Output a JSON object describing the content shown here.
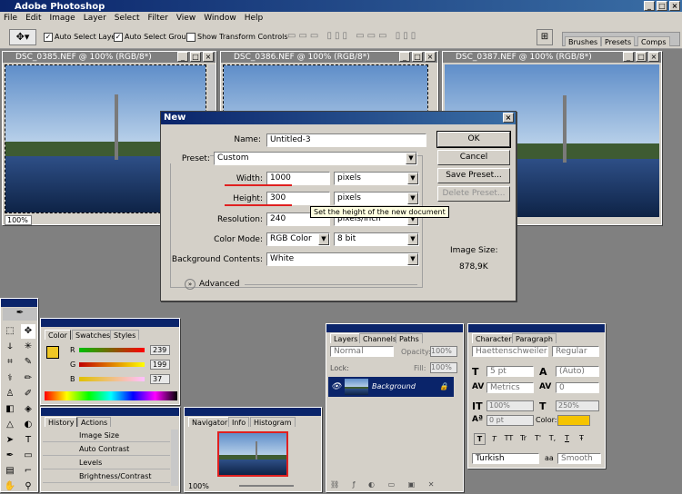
{
  "app": {
    "title": "Adobe Photoshop"
  },
  "menu": [
    "File",
    "Edit",
    "Image",
    "Layer",
    "Select",
    "Filter",
    "View",
    "Window",
    "Help"
  ],
  "options": {
    "auto_select_layer": "Auto Select Layer",
    "auto_select_groups": "Auto Select Groups",
    "show_transform": "Show Transform Controls",
    "auto_select_layer_checked": true,
    "auto_select_groups_checked": true,
    "show_transform_checked": false
  },
  "well_tabs": [
    "Brushes",
    "Presets",
    "Comps"
  ],
  "documents": [
    {
      "title": "DSC_0385.NEF @ 100% (RGB/8*)",
      "zoom": "100%"
    },
    {
      "title": "DSC_0386.NEF @ 100% (RGB/8*)"
    },
    {
      "title": "DSC_0387.NEF @ 100% (RGB/8*)"
    }
  ],
  "dialog": {
    "title": "New",
    "name_label": "Name:",
    "name_value": "Untitled-3",
    "preset_label": "Preset:",
    "preset_value": "Custom",
    "width_label": "Width:",
    "width_value": "1000",
    "width_unit": "pixels",
    "height_label": "Height:",
    "height_value": "300",
    "height_unit": "pixels",
    "resolution_label": "Resolution:",
    "resolution_value": "240",
    "resolution_unit": "pixels/inch",
    "tooltip": "Set the height of the new document",
    "color_mode_label": "Color Mode:",
    "color_mode_value": "RGB Color",
    "bit_value": "8 bit",
    "bg_label": "Background Contents:",
    "bg_value": "White",
    "advanced_label": "Advanced",
    "ok": "OK",
    "cancel": "Cancel",
    "save_preset": "Save Preset...",
    "delete_preset": "Delete Preset...",
    "image_size_label": "Image Size:",
    "image_size_value": "878,9K"
  },
  "color_panel": {
    "tabs": [
      "Color",
      "Swatches",
      "Styles"
    ],
    "r": "239",
    "g": "199",
    "b": "37",
    "r_label": "R",
    "g_label": "G",
    "b_label": "B",
    "fg_color": "#efc725"
  },
  "history_panel": {
    "tabs": [
      "History",
      "Actions"
    ],
    "items": [
      "Image Size",
      "Auto Contrast",
      "Levels",
      "Brightness/Contrast"
    ]
  },
  "navigator_panel": {
    "tabs": [
      "Navigator",
      "Info",
      "Histogram"
    ],
    "zoom": "100%"
  },
  "layers_panel": {
    "tabs": [
      "Layers",
      "Channels",
      "Paths"
    ],
    "blend": "Normal",
    "opacity_label": "Opacity:",
    "opacity": "100%",
    "lock_label": "Lock:",
    "fill_label": "Fill:",
    "fill": "100%",
    "layer_name": "Background"
  },
  "character_panel": {
    "tabs": [
      "Character",
      "Paragraph"
    ],
    "font": "Haettenschweiler",
    "style": "Regular",
    "size": "5 pt",
    "leading": "(Auto)",
    "kerning": "Metrics",
    "tracking": "0",
    "vscale": "100%",
    "hscale": "250%",
    "baseline": "0 pt",
    "color_label": "Color:",
    "color": "#f5c400",
    "language": "Turkish",
    "aa_label": "aa",
    "aa": "Smooth",
    "type_buttons": [
      "T",
      "T",
      "TT",
      "Tr",
      "T'",
      "T,",
      "T",
      "Ŧ"
    ]
  }
}
